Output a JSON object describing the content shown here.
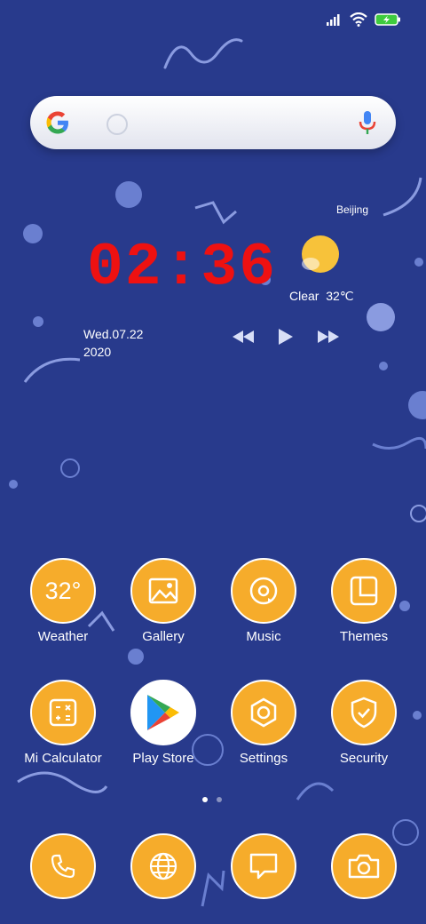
{
  "status_bar": {
    "icons": [
      "signal-icon",
      "wifi-icon",
      "battery-charging-icon"
    ]
  },
  "search": {
    "logo": "G"
  },
  "clock": {
    "time": "02:36"
  },
  "weather_widget": {
    "city": "Beijing",
    "condition": "Clear",
    "temperature": "32℃"
  },
  "date": {
    "line1": "Wed.07.22",
    "line2": "2020"
  },
  "music_controls": {
    "previous_icon": "◂◂",
    "play_icon": "▶",
    "next_icon": "▸▸"
  },
  "apps": [
    {
      "label": "Weather",
      "icon_text": "32°"
    },
    {
      "label": "Gallery"
    },
    {
      "label": "Music"
    },
    {
      "label": "Themes"
    },
    {
      "label": "Mi Calculator"
    },
    {
      "label": "Play Store"
    },
    {
      "label": "Settings"
    },
    {
      "label": "Security"
    }
  ],
  "dock": [
    "phone-icon",
    "browser-icon",
    "messages-icon",
    "camera-icon"
  ],
  "page_indicator": {
    "count": 2,
    "active": 1
  },
  "colors": {
    "background": "#283a8c",
    "icon_fill": "#f6ac2b",
    "clock": "#ee1111"
  }
}
